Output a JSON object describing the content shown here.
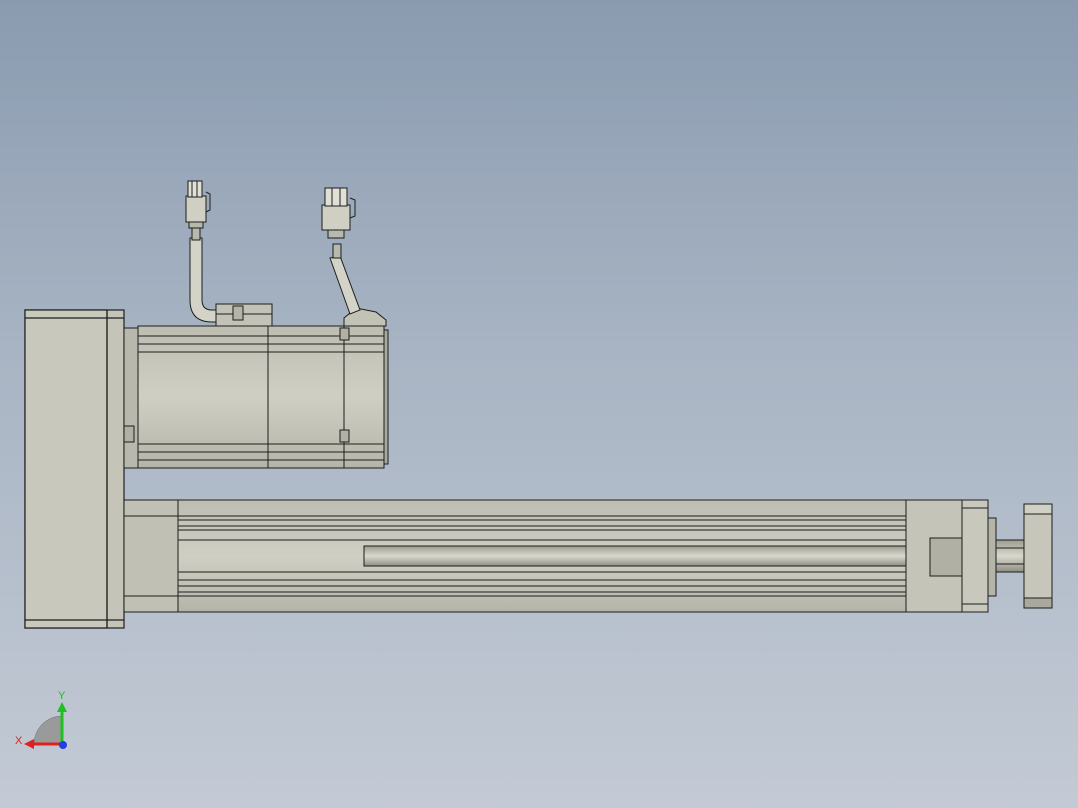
{
  "viewport": {
    "background_top": "#8a9bb0",
    "background_bottom": "#c3cad5"
  },
  "model": {
    "body_color": "#c6c6ba",
    "shade_color": "#a9a99d",
    "edge_color": "#1e1e1e"
  },
  "triad": {
    "x_label": "X",
    "y_label": "Y",
    "x_color": "#e02020",
    "y_color": "#20c020",
    "z_color": "#2040e0"
  }
}
